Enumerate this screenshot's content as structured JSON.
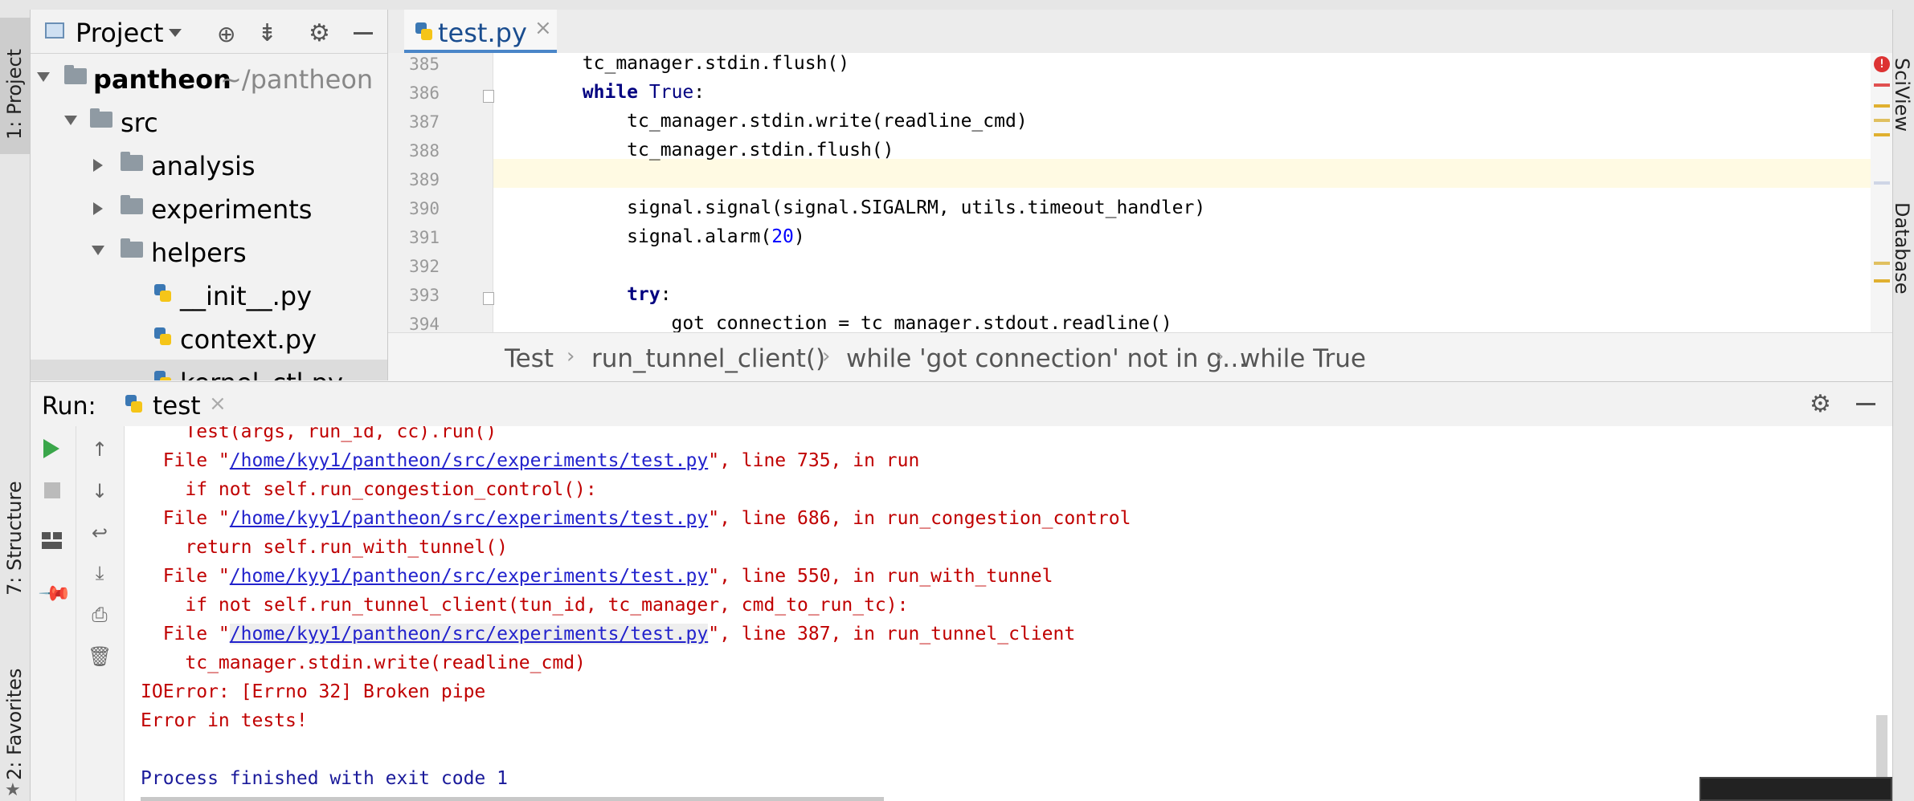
{
  "left_tool_windows": {
    "project": "1: Project",
    "structure": "7: Structure",
    "favorites": "2: Favorites"
  },
  "right_tool_windows": {
    "sciview": "SciView",
    "database": "Database"
  },
  "project_panel": {
    "title": "Project",
    "tree": [
      {
        "label": "pantheon",
        "hint": "~/pantheon",
        "type": "folder",
        "expanded": true,
        "bold": true
      },
      {
        "label": "src",
        "type": "folder",
        "expanded": true
      },
      {
        "label": "analysis",
        "type": "folder",
        "expanded": false
      },
      {
        "label": "experiments",
        "type": "folder",
        "expanded": false
      },
      {
        "label": "helpers",
        "type": "folder",
        "expanded": true
      },
      {
        "label": "__init__.py",
        "type": "python"
      },
      {
        "label": "context.py",
        "type": "python"
      },
      {
        "label": "kernel_ctl.py",
        "type": "python"
      }
    ]
  },
  "editor": {
    "tab_label": "test.py",
    "lines": [
      {
        "num": "385",
        "text": "        tc_manager.stdin.flush()"
      },
      {
        "num": "386",
        "text": "        while True:"
      },
      {
        "num": "387",
        "text": "            tc_manager.stdin.write(readline_cmd)"
      },
      {
        "num": "388",
        "text": "            tc_manager.stdin.flush()"
      },
      {
        "num": "389",
        "text": ""
      },
      {
        "num": "390",
        "text": "            signal.signal(signal.SIGALRM, utils.timeout_handler)"
      },
      {
        "num": "391",
        "text": "            signal.alarm(20)"
      },
      {
        "num": "392",
        "text": ""
      },
      {
        "num": "393",
        "text": "            try:"
      },
      {
        "num": "394",
        "text": "                got_connection = tc_manager.stdout.readline()"
      }
    ]
  },
  "breadcrumb": [
    "Test",
    "run_tunnel_client()",
    "while 'got connection' not in g…",
    "while True"
  ],
  "run_panel": {
    "label": "Run:",
    "tab": "test",
    "console": [
      {
        "kind": "err",
        "text": "    Test(args, run_id, cc).run()"
      },
      {
        "kind": "file",
        "pre": "  File \"",
        "link": "/home/kyy1/pantheon/src/experiments/test.py",
        "post": "\", line 735, in run"
      },
      {
        "kind": "err",
        "text": "    if not self.run_congestion_control():"
      },
      {
        "kind": "file",
        "pre": "  File \"",
        "link": "/home/kyy1/pantheon/src/experiments/test.py",
        "post": "\", line 686, in run_congestion_control"
      },
      {
        "kind": "err",
        "text": "    return self.run_with_tunnel()"
      },
      {
        "kind": "file",
        "pre": "  File \"",
        "link": "/home/kyy1/pantheon/src/experiments/test.py",
        "post": "\", line 550, in run_with_tunnel"
      },
      {
        "kind": "err",
        "text": "    if not self.run_tunnel_client(tun_id, tc_manager, cmd_to_run_tc):"
      },
      {
        "kind": "file",
        "pre": "  File \"",
        "link": "/home/kyy1/pantheon/src/experiments/test.py",
        "post": "\", line 387, in run_tunnel_client"
      },
      {
        "kind": "err",
        "text": "    tc_manager.stdin.write(readline_cmd)"
      },
      {
        "kind": "err",
        "text": "IOError: [Errno 32] Broken pipe"
      },
      {
        "kind": "err",
        "text": "Error in tests!"
      },
      {
        "kind": "blank",
        "text": ""
      },
      {
        "kind": "proc",
        "text": "Process finished with exit code 1"
      }
    ]
  },
  "icons": {
    "error_stripe_marker": "!"
  },
  "colors": {
    "error_text": "#c00000",
    "link": "#2222cc",
    "current_line": "#fffae3",
    "keyword": "#000080",
    "number": "#0000ff",
    "run_green": "#3aa64a"
  }
}
